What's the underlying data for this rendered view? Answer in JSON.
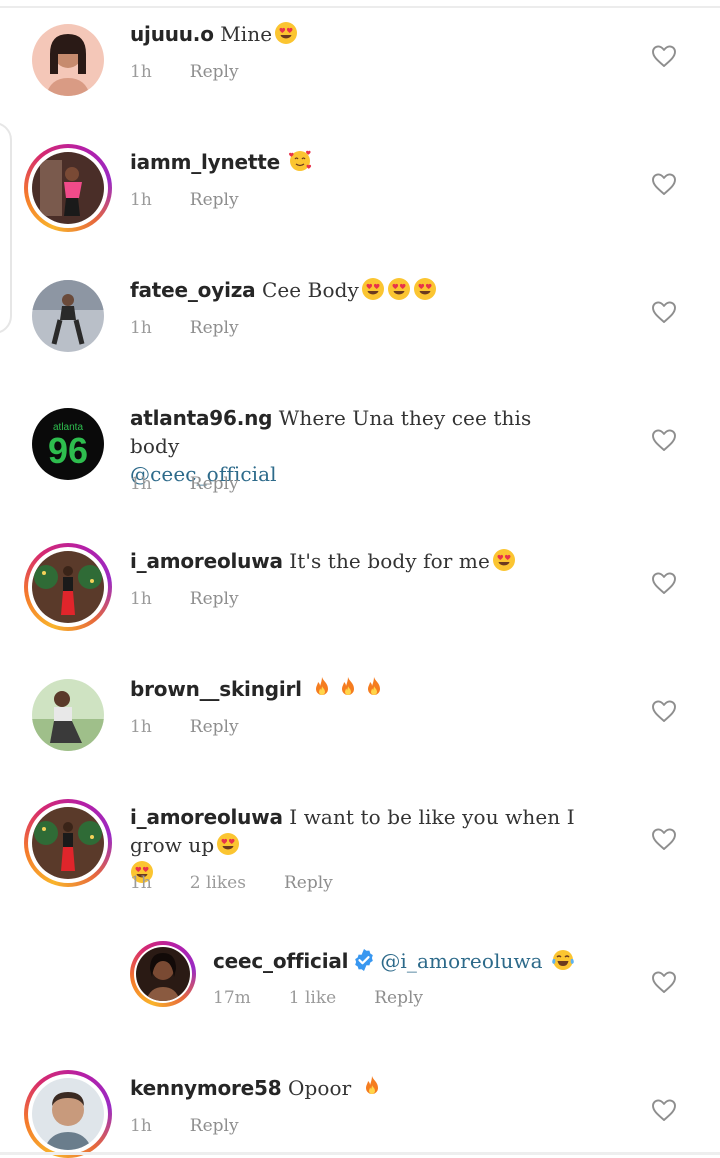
{
  "comments": [
    {
      "username": "ujuuu.o",
      "text": "Mine",
      "emojis": [
        "heart-eyes"
      ],
      "time": "1h",
      "likes": "",
      "reply_label": "Reply",
      "story_ring": false
    },
    {
      "username": "iamm_lynette",
      "text": "",
      "emojis": [
        "smiling-hearts"
      ],
      "time": "1h",
      "likes": "",
      "reply_label": "Reply",
      "story_ring": true
    },
    {
      "username": "fatee_oyiza",
      "text": "Cee Body",
      "emojis": [
        "heart-eyes",
        "heart-eyes",
        "heart-eyes"
      ],
      "time": "1h",
      "likes": "",
      "reply_label": "Reply",
      "story_ring": false
    },
    {
      "username": "atlanta96.ng",
      "text": "Where Una they cee this body",
      "mention": "@ceec_official",
      "avatar_text_top": "atlanta",
      "avatar_text_big": "96",
      "time": "1h",
      "likes": "",
      "reply_label": "Reply",
      "story_ring": false
    },
    {
      "username": "i_amoreoluwa",
      "text": "It's the body for me",
      "emojis": [
        "heart-eyes"
      ],
      "time": "1h",
      "likes": "",
      "reply_label": "Reply",
      "story_ring": true
    },
    {
      "username": "brown__skingirl",
      "text": "",
      "emojis": [
        "fire",
        "fire",
        "fire"
      ],
      "time": "1h",
      "likes": "",
      "reply_label": "Reply",
      "story_ring": false
    },
    {
      "username": "i_amoreoluwa",
      "text": "I want to be like you when I grow up",
      "emojis": [
        "heart-eyes",
        "heart-eyes"
      ],
      "time": "1h",
      "likes": "2 likes",
      "reply_label": "Reply",
      "story_ring": true
    },
    {
      "username": "ceec_official",
      "verified": true,
      "mention": "@i_amoreoluwa",
      "emojis": [
        "tears-of-joy"
      ],
      "time": "17m",
      "likes": "1 like",
      "reply_label": "Reply",
      "story_ring": true,
      "is_reply": true
    },
    {
      "username": "kennymore58",
      "text": "Opoor",
      "emojis": [
        "fire"
      ],
      "time": "1h",
      "likes": "",
      "reply_label": "Reply",
      "story_ring": true
    }
  ],
  "icons": {
    "like": "heart-outline-icon",
    "verified": "verified-badge-icon"
  },
  "colors": {
    "mention": "#2d6a8a",
    "meta": "#9b9b9b",
    "verified": "#3897f0"
  }
}
